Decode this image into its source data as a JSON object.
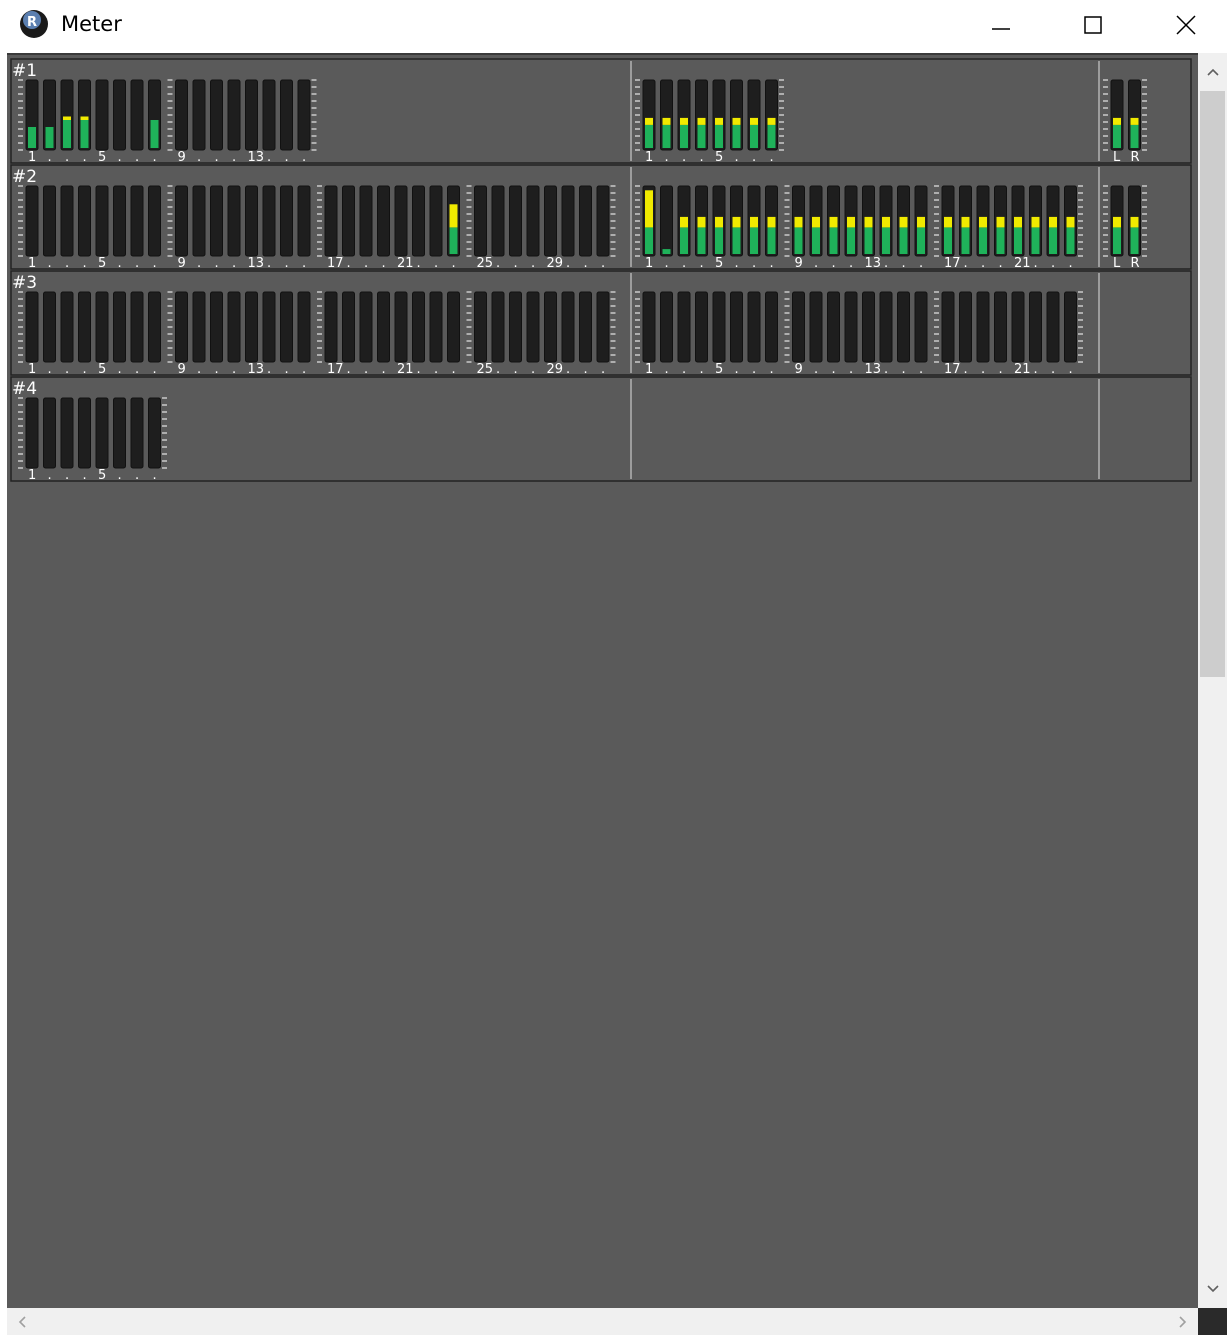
{
  "window": {
    "title": "Meter",
    "app_icon": "reaper-logo-icon",
    "controls": [
      "minimize-icon",
      "maximize-icon",
      "close-icon"
    ]
  },
  "colors": {
    "background": "#5a5a5a",
    "meter_trough": "#1e1e1e",
    "green": "#1fb25a",
    "yellow": "#f0ea00",
    "label": "#ffffff",
    "divider": "#222222"
  },
  "meter_panel": {
    "rows": [
      {
        "label": "#1",
        "inputs": {
          "channels": 16,
          "tick_labels": [
            "1",
            "5",
            "9",
            "13"
          ],
          "green": [
            0.3,
            0.3,
            0.4,
            0.4,
            0,
            0,
            0,
            0.4,
            0,
            0,
            0,
            0,
            0,
            0,
            0,
            0
          ],
          "yellow": [
            0,
            0,
            0.05,
            0.05,
            0,
            0,
            0,
            0,
            0,
            0,
            0,
            0,
            0,
            0,
            0,
            0
          ]
        },
        "outputs": {
          "channels": 8,
          "tick_labels": [
            "1",
            "5"
          ],
          "green": [
            0.33,
            0.33,
            0.33,
            0.33,
            0.33,
            0.33,
            0.33,
            0.33
          ],
          "yellow": [
            0.1,
            0.1,
            0.1,
            0.1,
            0.1,
            0.1,
            0.1,
            0.1
          ]
        },
        "master": {
          "channels": 2,
          "tick_labels": [
            "L",
            "R"
          ],
          "green": [
            0.33,
            0.33
          ],
          "yellow": [
            0.1,
            0.1
          ]
        }
      },
      {
        "label": "#2",
        "inputs": {
          "channels": 32,
          "tick_labels": [
            "1",
            "5",
            "9",
            "13",
            "17",
            "21",
            "25",
            "29"
          ],
          "green": [
            0,
            0,
            0,
            0,
            0,
            0,
            0,
            0,
            0,
            0,
            0,
            0,
            0,
            0,
            0,
            0,
            0,
            0,
            0,
            0,
            0,
            0,
            0,
            0.38,
            0,
            0,
            0,
            0,
            0,
            0,
            0,
            0
          ],
          "yellow": [
            0,
            0,
            0,
            0,
            0,
            0,
            0,
            0,
            0,
            0,
            0,
            0,
            0,
            0,
            0,
            0,
            0,
            0,
            0,
            0,
            0,
            0,
            0,
            0.33,
            0,
            0,
            0,
            0,
            0,
            0,
            0,
            0
          ]
        },
        "outputs": {
          "channels": 24,
          "tick_labels": [
            "1",
            "5",
            "9",
            "13",
            "17",
            "21"
          ],
          "green": [
            0.38,
            0.07,
            0.38,
            0.38,
            0.38,
            0.38,
            0.38,
            0.38,
            0.38,
            0.38,
            0.38,
            0.38,
            0.38,
            0.38,
            0.38,
            0.38,
            0.38,
            0.38,
            0.38,
            0.38,
            0.38,
            0.38,
            0.38,
            0.38
          ],
          "yellow": [
            0.53,
            0,
            0.15,
            0.15,
            0.15,
            0.15,
            0.15,
            0.15,
            0.15,
            0.15,
            0.15,
            0.15,
            0.15,
            0.15,
            0.15,
            0.15,
            0.15,
            0.15,
            0.15,
            0.15,
            0.15,
            0.15,
            0.15,
            0.15
          ]
        },
        "master": {
          "channels": 2,
          "tick_labels": [
            "L",
            "R"
          ],
          "green": [
            0.38,
            0.38
          ],
          "yellow": [
            0.15,
            0.15
          ]
        }
      },
      {
        "label": "#3",
        "inputs": {
          "channels": 32,
          "tick_labels": [
            "1",
            "5",
            "9",
            "13",
            "17",
            "21",
            "25",
            "29"
          ],
          "green": [],
          "yellow": []
        },
        "outputs": {
          "channels": 24,
          "tick_labels": [
            "1",
            "5",
            "9",
            "13",
            "17",
            "21"
          ],
          "green": [],
          "yellow": []
        },
        "master": null
      },
      {
        "label": "#4",
        "inputs": {
          "channels": 8,
          "tick_labels": [
            "1",
            "5"
          ],
          "green": [],
          "yellow": []
        },
        "outputs": null,
        "master": null
      }
    ]
  }
}
